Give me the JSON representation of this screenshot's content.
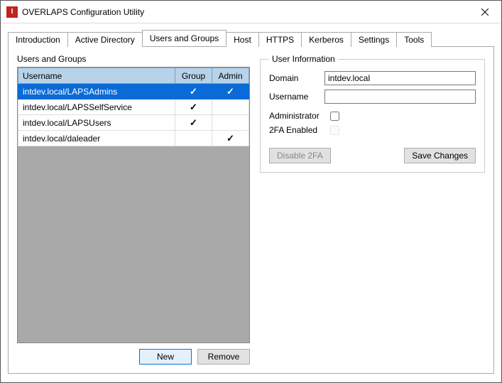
{
  "window": {
    "title": "OVERLAPS Configuration Utility",
    "app_icon_letter": "I"
  },
  "tabs": [
    {
      "label": "Introduction",
      "active": false
    },
    {
      "label": "Active Directory",
      "active": false
    },
    {
      "label": "Users and Groups",
      "active": true
    },
    {
      "label": "Host",
      "active": false
    },
    {
      "label": "HTTPS",
      "active": false
    },
    {
      "label": "Kerberos",
      "active": false
    },
    {
      "label": "Settings",
      "active": false
    },
    {
      "label": "Tools",
      "active": false
    }
  ],
  "users_groups": {
    "section_label": "Users and Groups",
    "columns": {
      "username": "Username",
      "group": "Group",
      "admin": "Admin"
    },
    "rows": [
      {
        "username": "intdev.local/LAPSAdmins",
        "group": true,
        "admin": true,
        "selected": true
      },
      {
        "username": "intdev.local/LAPSSelfService",
        "group": true,
        "admin": false,
        "selected": false
      },
      {
        "username": "intdev.local/LAPSUsers",
        "group": true,
        "admin": false,
        "selected": false
      },
      {
        "username": "intdev.local/daleader",
        "group": false,
        "admin": true,
        "selected": false
      }
    ],
    "buttons": {
      "new": "New",
      "remove": "Remove"
    }
  },
  "user_info": {
    "legend": "User Information",
    "domain_label": "Domain",
    "domain_value": "intdev.local",
    "username_label": "Username",
    "username_value": "",
    "administrator_label": "Administrator",
    "administrator_checked": false,
    "twofa_label": "2FA Enabled",
    "twofa_checked": false,
    "twofa_disabled": true,
    "disable_2fa_btn": "Disable 2FA",
    "disable_2fa_btn_disabled": true,
    "save_btn": "Save Changes"
  }
}
